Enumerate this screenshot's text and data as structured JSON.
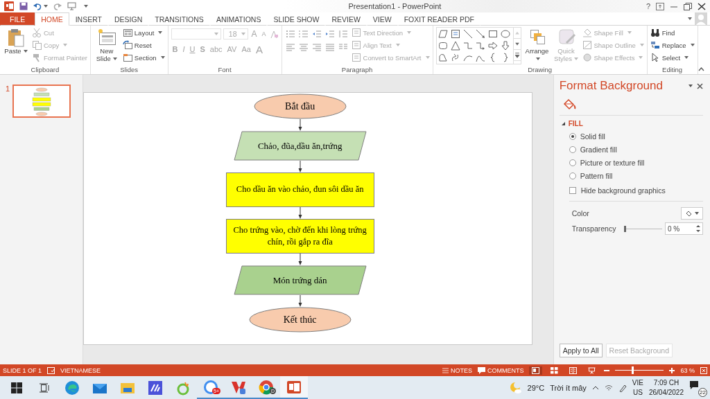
{
  "title_bar": {
    "title": "Presentation1 - PowerPoint",
    "help": "?"
  },
  "tabs": [
    {
      "label": "FILE",
      "kind": "file",
      "selected": false
    },
    {
      "label": "HOME",
      "kind": "tab",
      "selected": true
    },
    {
      "label": "INSERT",
      "kind": "tab",
      "selected": false
    },
    {
      "label": "DESIGN",
      "kind": "tab",
      "selected": false
    },
    {
      "label": "TRANSITIONS",
      "kind": "tab",
      "selected": false
    },
    {
      "label": "ANIMATIONS",
      "kind": "tab",
      "selected": false
    },
    {
      "label": "SLIDE SHOW",
      "kind": "tab",
      "selected": false
    },
    {
      "label": "REVIEW",
      "kind": "tab",
      "selected": false
    },
    {
      "label": "VIEW",
      "kind": "tab",
      "selected": false
    },
    {
      "label": "FOXIT READER PDF",
      "kind": "tab",
      "selected": false
    }
  ],
  "ribbon": [
    {
      "label": "Clipboard",
      "kind": "buttons",
      "large_buttons": [
        {
          "label": "Paste",
          "disabled": false,
          "dropdown": true
        }
      ],
      "small_buttons": [
        {
          "label": "Cut",
          "disabled": true,
          "dropdown": false
        },
        {
          "label": "Copy",
          "disabled": true,
          "dropdown": true
        },
        {
          "label": "Format Painter",
          "disabled": true,
          "dropdown": false
        }
      ]
    },
    {
      "label": "Slides",
      "kind": "buttons",
      "large_buttons": [
        {
          "label": "New Slide",
          "disabled": false,
          "dropdown": true
        }
      ],
      "small_buttons": [
        {
          "label": "Layout",
          "disabled": false,
          "dropdown": true
        },
        {
          "label": "Reset",
          "disabled": false,
          "dropdown": false
        },
        {
          "label": "Section",
          "disabled": false,
          "dropdown": true
        }
      ]
    },
    {
      "label": "Font",
      "kind": "font",
      "font_size": "18",
      "rows": [
        [
          "A",
          "A"
        ],
        [
          "B",
          "I",
          "U",
          "S",
          "abc",
          "AV",
          "Aa",
          "A"
        ]
      ]
    },
    {
      "label": "Paragraph",
      "kind": "paragraph",
      "small_buttons": [
        {
          "label": "Text Direction",
          "disabled": true,
          "dropdown": true
        },
        {
          "label": "Align Text",
          "disabled": true,
          "dropdown": true
        },
        {
          "label": "Convert to SmartArt",
          "disabled": true,
          "dropdown": true
        }
      ]
    },
    {
      "label": "Drawing",
      "kind": "drawing",
      "large_buttons": [
        {
          "label": "Arrange",
          "disabled": false,
          "dropdown": true
        },
        {
          "label": "Quick Styles",
          "disabled": true,
          "dropdown": true
        }
      ],
      "small_buttons": [
        {
          "label": "Shape Fill",
          "disabled": true,
          "dropdown": true
        },
        {
          "label": "Shape Outline",
          "disabled": true,
          "dropdown": true
        },
        {
          "label": "Shape Effects",
          "disabled": true,
          "dropdown": true
        }
      ]
    },
    {
      "label": "Editing",
      "kind": "buttons",
      "small_buttons": [
        {
          "label": "Find",
          "disabled": false,
          "dropdown": false
        },
        {
          "label": "Replace",
          "disabled": false,
          "dropdown": true
        },
        {
          "label": "Select",
          "disabled": false,
          "dropdown": true
        }
      ]
    }
  ],
  "slides": [
    {
      "number": "1",
      "selected": true
    }
  ],
  "slide": {
    "nodes": [
      {
        "kind": "ellipse",
        "text": "Bắt đầu",
        "color": "#f8cbad"
      },
      {
        "kind": "parallelogram",
        "text": "Chảo, đũa,dầu ăn,trứng",
        "color": "#c5e0b4"
      },
      {
        "kind": "rect",
        "text": "Cho dầu ăn vào chảo, đun sôi dầu ăn",
        "color": "#ffff00"
      },
      {
        "kind": "rect",
        "text": "Cho trứng vào, chờ đến khi lòng trứng chín, rồi gắp ra đĩa",
        "color": "#ffff00"
      },
      {
        "kind": "parallelogram",
        "text": "Món trứng dán",
        "color": "#a9d18e"
      },
      {
        "kind": "ellipse",
        "text": "Kết thúc",
        "color": "#f8cbad"
      }
    ]
  },
  "format_panel": {
    "title": "Format Background",
    "section": "FILL",
    "expanded": true,
    "options": [
      {
        "kind": "radio",
        "label": "Solid fill",
        "selected": true
      },
      {
        "kind": "radio",
        "label": "Gradient fill",
        "selected": false
      },
      {
        "kind": "radio",
        "label": "Picture or texture fill",
        "selected": false
      },
      {
        "kind": "radio",
        "label": "Pattern fill",
        "selected": false
      },
      {
        "kind": "checkbox",
        "label": "Hide background graphics",
        "checked": false
      }
    ],
    "color_label": "Color",
    "transparency": {
      "label": "Transparency",
      "level": 0,
      "value": "0 %"
    },
    "buttons": [
      {
        "label": "Apply to All",
        "disabled": false
      },
      {
        "label": "Reset Background",
        "disabled": true
      }
    ]
  },
  "status_bar": {
    "slide_info": "SLIDE 1 OF 1",
    "language": "VIETNAMESE",
    "notes": "NOTES",
    "comments": "COMMENTS",
    "views": [
      {
        "selected": true
      },
      {
        "selected": false
      },
      {
        "selected": false
      },
      {
        "selected": false
      }
    ],
    "zoom": {
      "level": 0.35,
      "value": "63 %"
    }
  },
  "taskbar": {
    "apps": [
      {
        "kind": "start",
        "running": false
      },
      {
        "kind": "taskview",
        "running": false
      },
      {
        "kind": "edge",
        "running": false
      },
      {
        "kind": "mail",
        "running": false
      },
      {
        "kind": "folder",
        "running": false
      },
      {
        "kind": "m",
        "running": false
      },
      {
        "kind": "coccoc",
        "running": false
      },
      {
        "kind": "zalo",
        "running": true,
        "badge": "5+"
      },
      {
        "kind": "vivaldi",
        "running": true
      },
      {
        "kind": "chrome",
        "running": true,
        "badge": "D"
      },
      {
        "kind": "powerpoint",
        "running": true
      }
    ],
    "weather": {
      "temp": "29°C",
      "text": "Trời ít mây"
    },
    "lang": [
      "VIE",
      "US"
    ],
    "time": "7:09 CH",
    "date": "26/04/2022",
    "notifications": "22"
  }
}
